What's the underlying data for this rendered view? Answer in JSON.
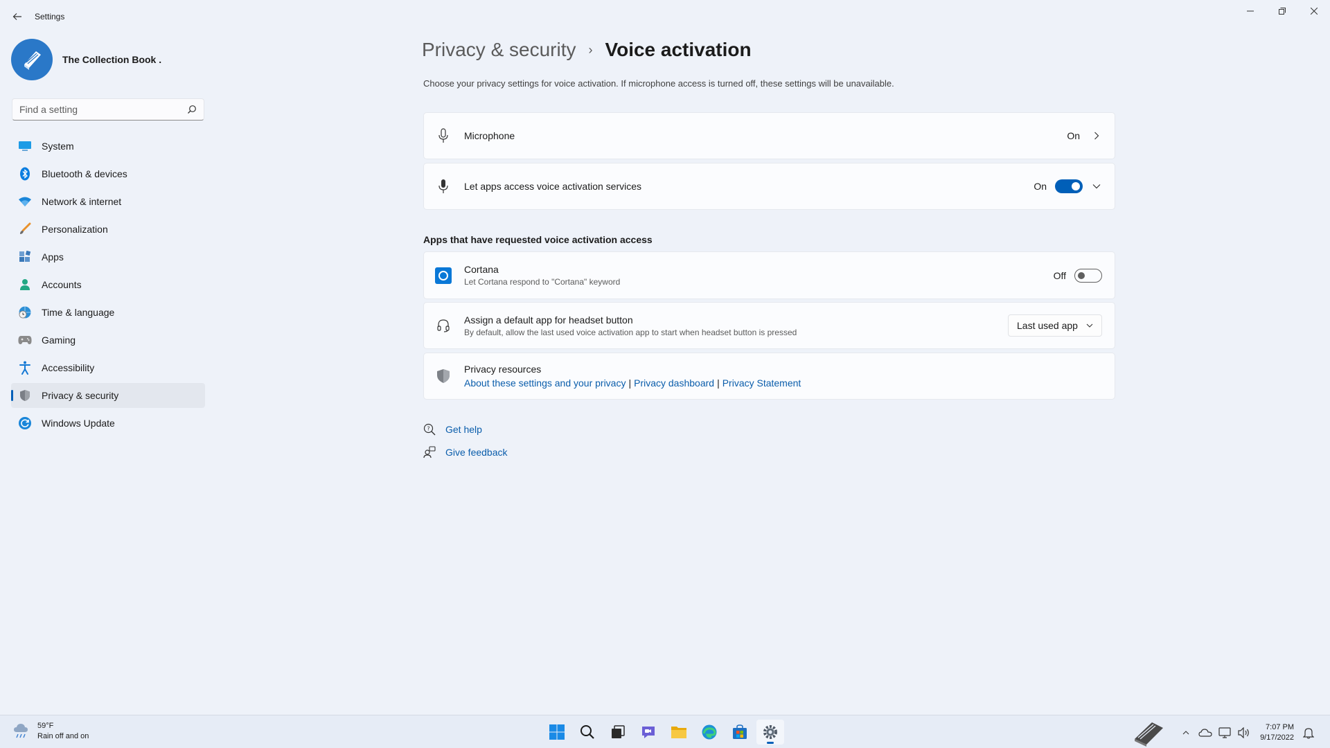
{
  "window": {
    "title": "Settings"
  },
  "profile": {
    "name": "The Collection Book ."
  },
  "search": {
    "placeholder": "Find a setting"
  },
  "sidebar": {
    "items": [
      {
        "label": "System",
        "icon": "system-icon"
      },
      {
        "label": "Bluetooth & devices",
        "icon": "bluetooth-icon"
      },
      {
        "label": "Network & internet",
        "icon": "wifi-icon"
      },
      {
        "label": "Personalization",
        "icon": "brush-icon"
      },
      {
        "label": "Apps",
        "icon": "apps-icon"
      },
      {
        "label": "Accounts",
        "icon": "account-icon"
      },
      {
        "label": "Time & language",
        "icon": "globe-clock-icon"
      },
      {
        "label": "Gaming",
        "icon": "gamepad-icon"
      },
      {
        "label": "Accessibility",
        "icon": "accessibility-icon"
      },
      {
        "label": "Privacy & security",
        "icon": "shield-icon",
        "active": true
      },
      {
        "label": "Windows Update",
        "icon": "update-icon"
      }
    ]
  },
  "header": {
    "parent": "Privacy & security",
    "separator": "›",
    "current": "Voice activation",
    "description": "Choose your privacy settings for voice activation. If microphone access is turned off, these settings will be unavailable."
  },
  "microphone": {
    "title": "Microphone",
    "state": "On"
  },
  "voice_access": {
    "title": "Let apps access voice activation services",
    "state": "On"
  },
  "apps_section": {
    "heading": "Apps that have requested voice activation access"
  },
  "cortana": {
    "title": "Cortana",
    "subtitle": "Let Cortana respond to \"Cortana\" keyword",
    "state": "Off"
  },
  "headset": {
    "title": "Assign a default app for headset button",
    "subtitle": "By default, allow the last used voice activation app to start when headset button is pressed",
    "selected": "Last used app"
  },
  "privacy_resources": {
    "title": "Privacy resources",
    "links": [
      "About these settings and your privacy",
      "Privacy dashboard",
      "Privacy Statement"
    ],
    "separator": "|"
  },
  "help": {
    "get_help": "Get help",
    "give_feedback": "Give feedback"
  },
  "taskbar": {
    "weather_temp": "59°F",
    "weather_desc": "Rain off and on",
    "time": "7:07 PM",
    "date": "9/17/2022"
  },
  "colors": {
    "accent": "#005fb8",
    "link": "#0a5dab",
    "background": "#eef2f9"
  }
}
